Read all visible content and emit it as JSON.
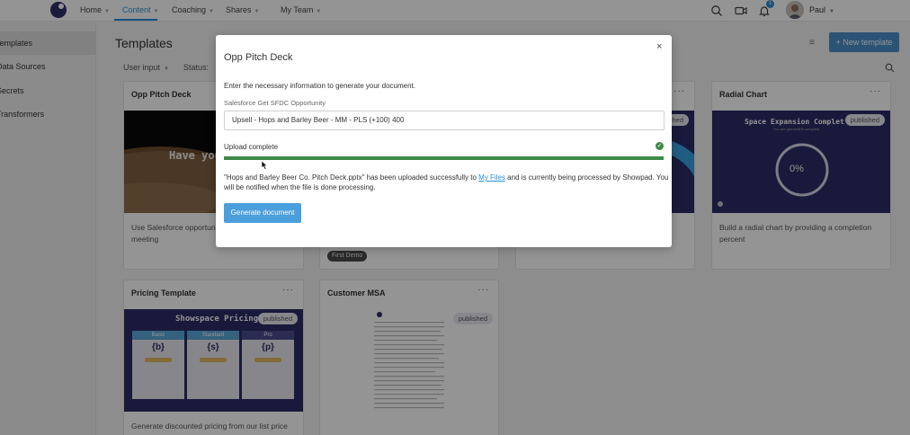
{
  "nav": {
    "items": [
      {
        "label": "Home",
        "active": false
      },
      {
        "label": "Content",
        "active": true
      },
      {
        "label": "Coaching",
        "active": false
      },
      {
        "label": "Shares",
        "active": false
      },
      {
        "label": "My Team",
        "active": false
      }
    ],
    "notification_count": "1",
    "user_name": "Paul",
    "accent_color": "#2a8ed8"
  },
  "sidebar": {
    "items": [
      {
        "label": "Templates",
        "active": true
      },
      {
        "label": "Data Sources",
        "active": false
      },
      {
        "label": "Secrets",
        "active": false
      },
      {
        "label": "Transformers",
        "active": false
      }
    ]
  },
  "main": {
    "title": "Templates",
    "filters": {
      "user_input": "User input",
      "status": "Status:"
    },
    "new_button": "+ New template",
    "cards": [
      {
        "title": "Opp Pitch Deck",
        "thumb_text": "Have you con galactic e",
        "description": "Use Salesforce opportunity deck for your next meeting"
      },
      {
        "title": "",
        "tag": "First Demo"
      },
      {
        "title": "",
        "badge": "published"
      },
      {
        "title": "Radial Chart",
        "badge": "published",
        "thumb_title": "Space Expansion Complet",
        "thumb_subtitle": "You are [percent]% complete",
        "gauge_label": "0%",
        "description": "Build a radial chart by providing a completion percent"
      },
      {
        "title": "Pricing Template",
        "badge": "published",
        "thumb_title": "Showspace Pricing",
        "tiers": [
          "Basic",
          "Standard",
          "Pro"
        ],
        "tier_symbols": [
          "{b}",
          "{s}",
          "{p}"
        ],
        "description": "Generate discounted pricing from our list price based on a provided percentage"
      },
      {
        "title": "Customer MSA",
        "badge": "published"
      }
    ]
  },
  "modal": {
    "title": "Opp Pitch Deck",
    "close": "×",
    "instruction": "Enter the necessary information to generate your document.",
    "field_label": "Salesforce Get SFDC Opportunity",
    "field_value": "Upsell - Hops and Barley Beer - MM - PLS (+100) 400",
    "upload_label": "Upload complete",
    "upload_progress": 1.0,
    "message_part1": "\"Hops and Barley Beer Co. Pitch Deck.pptx\" has been uploaded successfully to ",
    "message_link": "My Files",
    "message_part2": " and is currently being processed by Showpad. You will be notified when the file is done processing.",
    "generate_button": "Generate document",
    "success_color": "#3c8a46"
  }
}
